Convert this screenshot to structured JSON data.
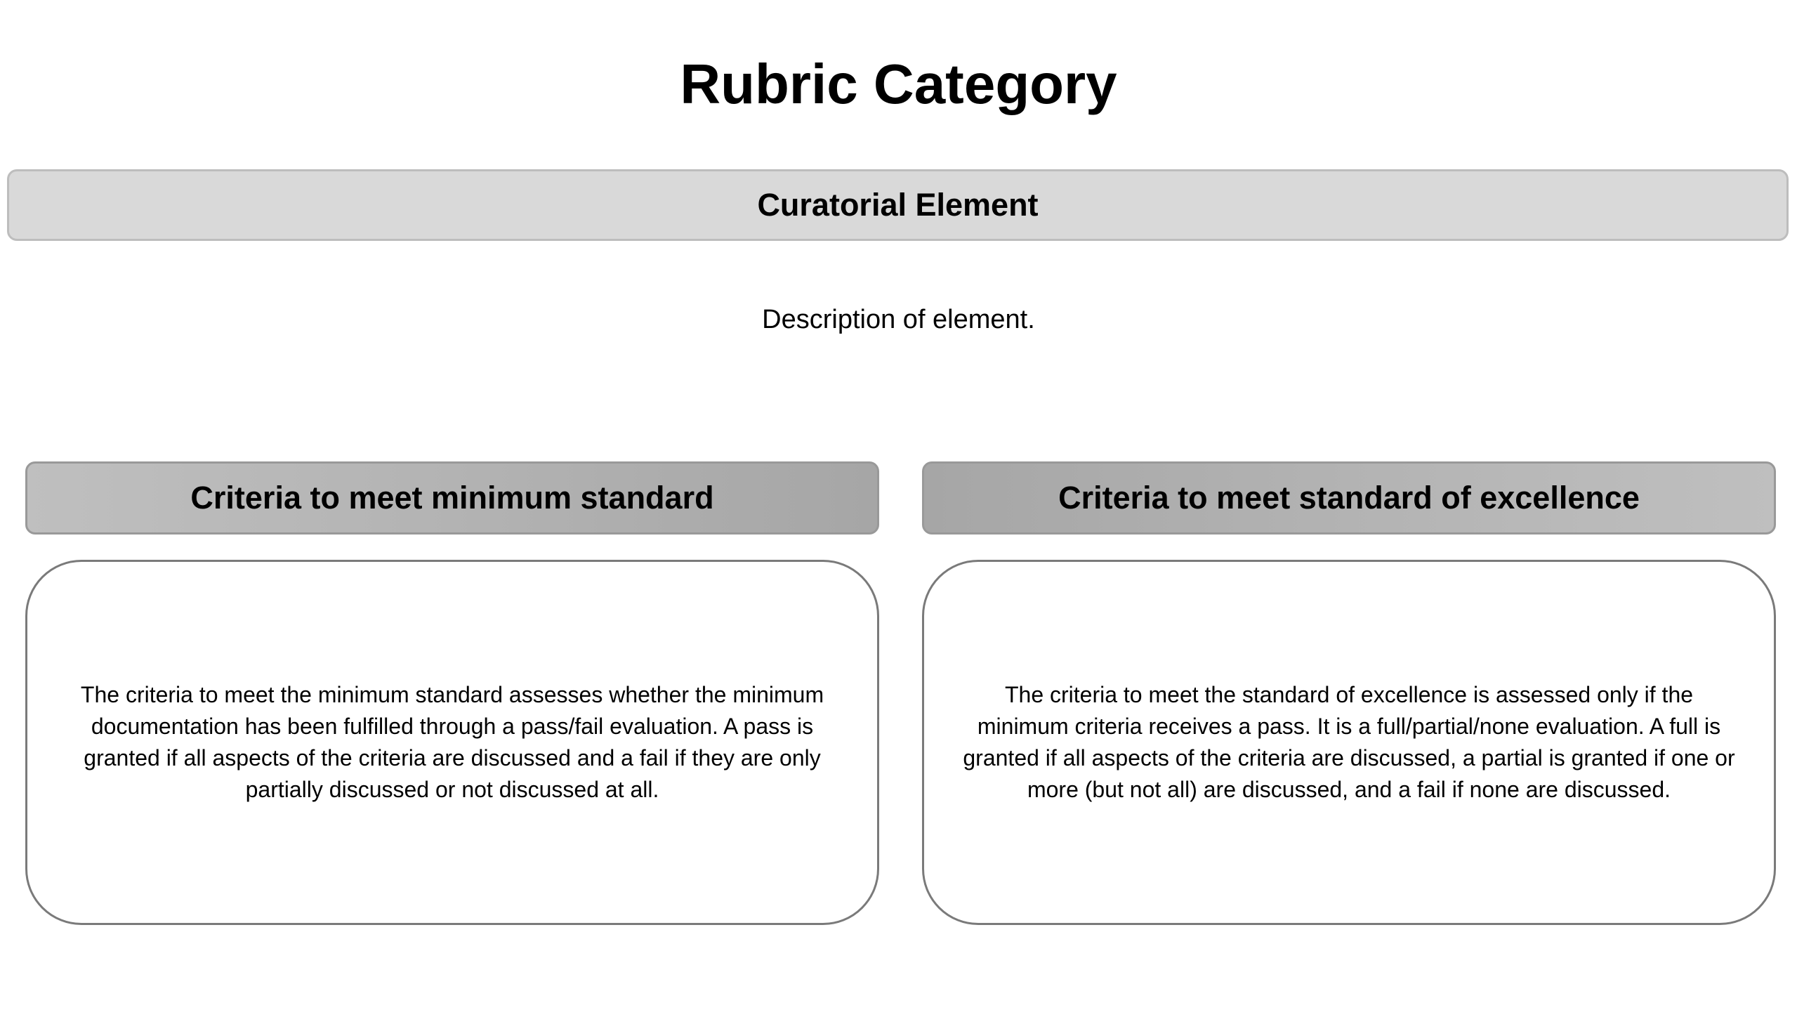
{
  "page": {
    "title": "Rubric Category"
  },
  "element": {
    "title": "Curatorial Element",
    "description": "Description of element."
  },
  "criteria": [
    {
      "header": "Criteria to meet minimum standard",
      "text": "The criteria to meet the minimum standard assesses whether the minimum documentation has been fulfilled through a pass/fail evaluation. A pass is granted if all aspects of the criteria are discussed and a fail if they are only partially discussed or not discussed at all."
    },
    {
      "header": "Criteria to meet standard of excellence",
      "text": "The criteria to meet the standard of excellence is assessed only if the minimum criteria receives a pass. It is a full/partial/none evaluation. A full is granted if all aspects of the criteria are discussed, a partial is granted if one or more (but not all) are discussed, and a fail if none are discussed."
    }
  ],
  "colors": {
    "element_bar_fill": "#d9d9d9",
    "element_bar_border": "#bdbdbd",
    "header_fill_light": "#bfbfbf",
    "header_fill_dark": "#a6a6a6",
    "box_border": "#7a7a7a",
    "text": "#000000"
  }
}
